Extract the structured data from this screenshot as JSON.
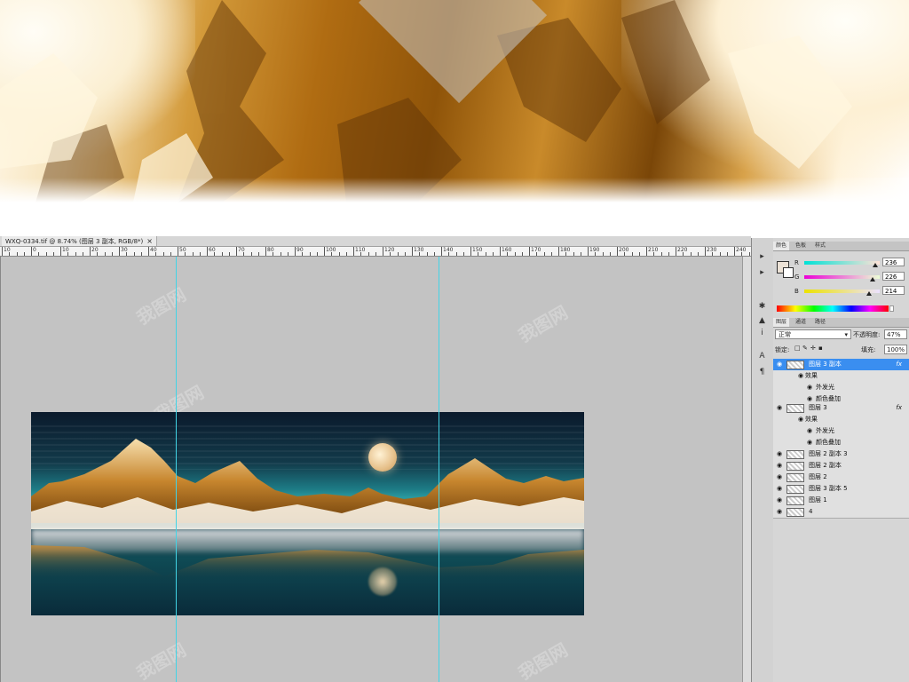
{
  "document_tab": {
    "title": "WXQ-0334.tif @ 8.74% (图层 3 副本, RGB/8*)",
    "close": "×"
  },
  "ruler": {
    "labels": [
      "10",
      "0",
      "10",
      "20",
      "30",
      "40",
      "50",
      "60",
      "70",
      "80",
      "90",
      "100",
      "110",
      "120",
      "130",
      "140",
      "150",
      "160",
      "170",
      "180",
      "190",
      "200",
      "210",
      "220",
      "230",
      "240"
    ]
  },
  "watermark": {
    "text": "我图网"
  },
  "tools": {
    "items": [
      "▸",
      "▸",
      "✱",
      "▲",
      "i",
      "A",
      "¶"
    ]
  },
  "color_panel": {
    "tabs": [
      "颜色",
      "色板",
      "样式"
    ],
    "r_label": "R",
    "r_value": "236",
    "g_label": "G",
    "g_value": "226",
    "b_label": "B",
    "b_value": "214",
    "fg_color": "#ece2d6"
  },
  "layers_panel": {
    "tabs": [
      "图层",
      "通道",
      "路径"
    ],
    "blend_mode": "正常",
    "opacity_label": "不透明度:",
    "opacity_value": "47%",
    "lock_label": "锁定:",
    "fill_label": "填充:",
    "fill_value": "100%",
    "layers": [
      {
        "name": "图层 3 副本",
        "fx": "fx",
        "selected": true
      },
      {
        "name": "效果",
        "sub": true
      },
      {
        "name": "外发光",
        "effect": true
      },
      {
        "name": "颜色叠加",
        "effect": true
      },
      {
        "name": "图层 3",
        "fx": "fx"
      },
      {
        "name": "效果",
        "sub": true
      },
      {
        "name": "外发光",
        "effect": true
      },
      {
        "name": "颜色叠加",
        "effect": true
      },
      {
        "name": "图层 2 副本 3"
      },
      {
        "name": "图层 2 副本"
      },
      {
        "name": "图层 2"
      },
      {
        "name": "图层 3 副本 5"
      },
      {
        "name": "图层 1"
      },
      {
        "name": "4"
      }
    ]
  }
}
